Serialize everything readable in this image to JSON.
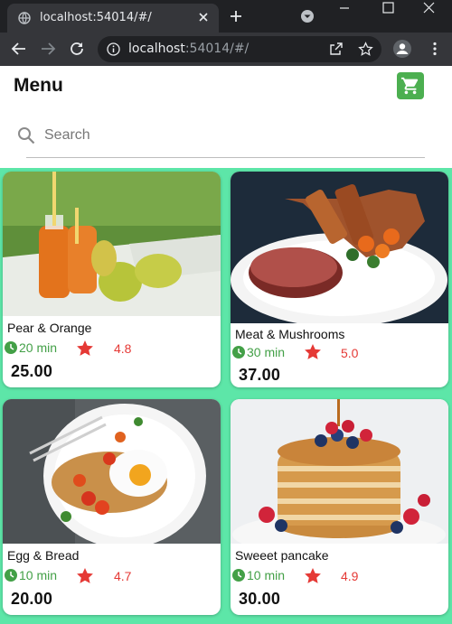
{
  "browser": {
    "tab_title": "localhost:54014/#/",
    "url_host": "localhost",
    "url_rest": ":54014/#/"
  },
  "app": {
    "title": "Menu",
    "search_placeholder": "Search",
    "accent_color": "#4caf50",
    "background_color": "#5de6a8"
  },
  "items": [
    {
      "name": "Pear & Orange",
      "time": "20 min",
      "rating": "4.8",
      "price": "25.00"
    },
    {
      "name": "Meat & Mushrooms",
      "time": "30 min",
      "rating": "5.0",
      "price": "37.00"
    },
    {
      "name": "Egg & Bread",
      "time": "10 min",
      "rating": "4.7",
      "price": "20.00"
    },
    {
      "name": "Sweeet pancake",
      "time": "10 min",
      "rating": "4.9",
      "price": "30.00"
    }
  ]
}
